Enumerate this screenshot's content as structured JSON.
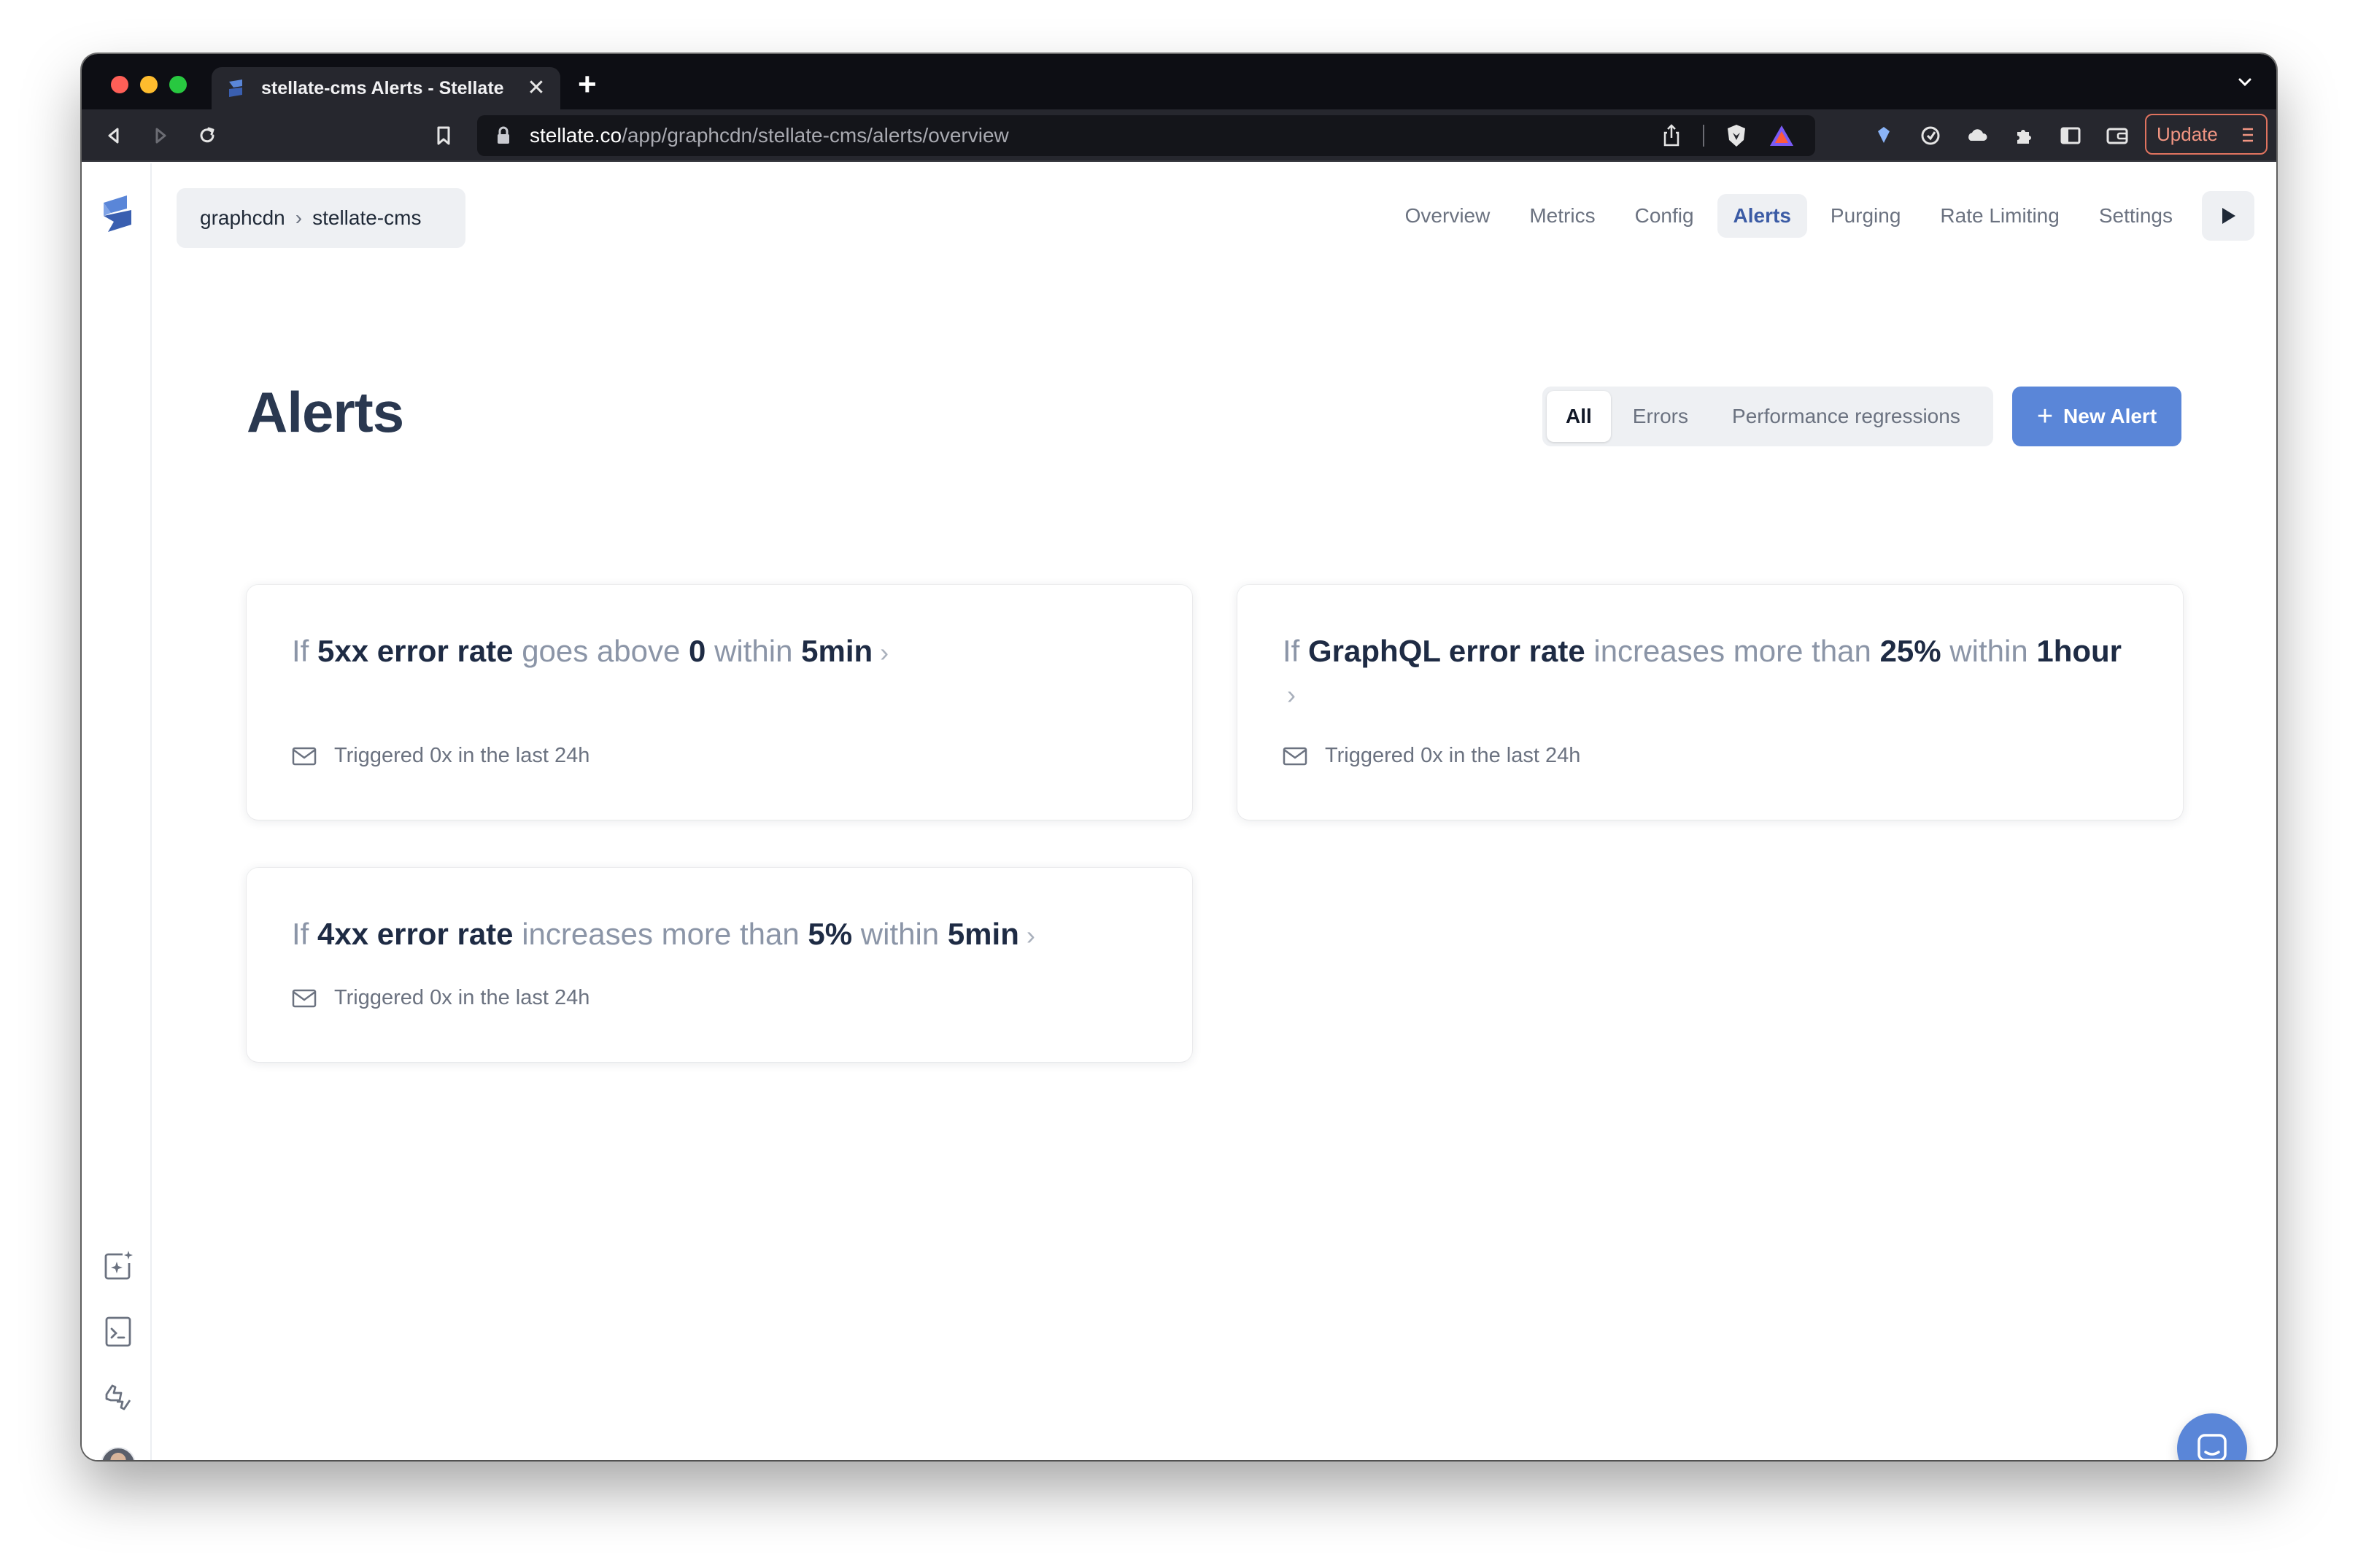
{
  "browser": {
    "tab_title": "stellate-cms Alerts - Stellate",
    "tab_close": "✕",
    "new_tab": "+",
    "url_host": "stellate.co",
    "url_path": "/app/graphcdn/stellate-cms/alerts/overview",
    "update_label": "Update"
  },
  "breadcrumb": {
    "org": "graphcdn",
    "separator": "›",
    "project": "stellate-cms"
  },
  "nav": {
    "items": [
      "Overview",
      "Metrics",
      "Config",
      "Alerts",
      "Purging",
      "Rate Limiting",
      "Settings"
    ],
    "active": "Alerts"
  },
  "page": {
    "title": "Alerts"
  },
  "filter": {
    "options": [
      "All",
      "Errors",
      "Performance regressions"
    ],
    "selected": "All"
  },
  "new_alert": {
    "plus": "+",
    "label": "New Alert"
  },
  "alerts": [
    {
      "parts": [
        {
          "t": "If ",
          "hl": false
        },
        {
          "t": "5xx error rate",
          "hl": true
        },
        {
          "t": " goes above ",
          "hl": false
        },
        {
          "t": "0",
          "hl": true
        },
        {
          "t": " within ",
          "hl": false
        },
        {
          "t": "5min",
          "hl": true
        }
      ],
      "chevron": "›",
      "triggered": "Triggered 0x in the last 24h"
    },
    {
      "parts": [
        {
          "t": "If ",
          "hl": false
        },
        {
          "t": "GraphQL error rate",
          "hl": true
        },
        {
          "t": " increases more than ",
          "hl": false
        },
        {
          "t": "25%",
          "hl": true
        },
        {
          "t": " within ",
          "hl": false
        },
        {
          "t": "1hour",
          "hl": true
        }
      ],
      "chevron": "›",
      "triggered": "Triggered 0x in the last 24h"
    },
    {
      "parts": [
        {
          "t": "If ",
          "hl": false
        },
        {
          "t": "4xx error rate",
          "hl": true
        },
        {
          "t": " increases more than ",
          "hl": false
        },
        {
          "t": "5%",
          "hl": true
        },
        {
          "t": " within ",
          "hl": false
        },
        {
          "t": "5min",
          "hl": true
        }
      ],
      "chevron": "›",
      "triggered": "Triggered 0x in the last 24h"
    }
  ],
  "colors": {
    "accent": "#5a86d8",
    "active_nav": "#3b5ba5",
    "title": "#2a3850",
    "muted": "#8b95a7"
  },
  "icons": {
    "logo": "stellate-logo-icon",
    "sidebar": [
      "ai-sparkle-icon",
      "terminal-icon",
      "feedback-icon"
    ],
    "chat": "chat-bubble-icon",
    "alert_meta": "mail-icon"
  }
}
